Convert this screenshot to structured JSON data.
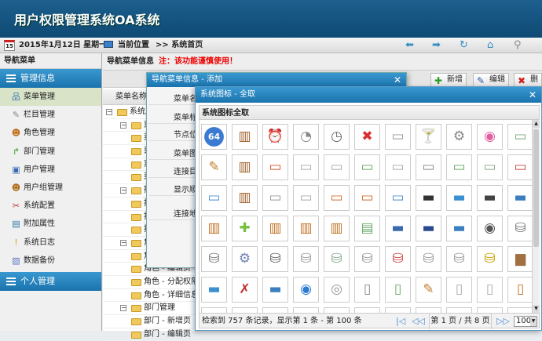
{
  "app": {
    "title": "用户权限管理系统OA系统"
  },
  "topbar": {
    "date": "2015年1月12日 星期一",
    "calendar_day": "15",
    "location_label": "当前位置",
    "breadcrumb": ">> 系统首页"
  },
  "nav": {
    "header": "导航菜单",
    "sections": [
      {
        "label": "管理信息"
      },
      {
        "label": "个人管理"
      }
    ],
    "items": [
      {
        "label": "菜单管理",
        "icon": "sitemap-icon",
        "glyph": "品",
        "color": "#3a7ab0"
      },
      {
        "label": "栏目管理",
        "icon": "wrench-icon",
        "glyph": "✎",
        "color": "#888"
      },
      {
        "label": "角色管理",
        "icon": "users-icon",
        "glyph": "☻",
        "color": "#c07020"
      },
      {
        "label": "部门管理",
        "icon": "branch-icon",
        "glyph": "↱",
        "color": "#3a9a20"
      },
      {
        "label": "用户管理",
        "icon": "user-card-icon",
        "glyph": "▣",
        "color": "#3a6ab0"
      },
      {
        "label": "用户组管理",
        "icon": "user-group-icon",
        "glyph": "☻",
        "color": "#b07020"
      },
      {
        "label": "系统配置",
        "icon": "tools-icon",
        "glyph": "✂",
        "color": "#c03030"
      },
      {
        "label": "附加属性",
        "icon": "book-icon",
        "glyph": "▤",
        "color": "#2a7aa0"
      },
      {
        "label": "系统日志",
        "icon": "warning-icon",
        "glyph": "!",
        "color": "#d8a000"
      },
      {
        "label": "数据备份",
        "icon": "document-icon",
        "glyph": "▧",
        "color": "#5a7ac0"
      }
    ]
  },
  "main": {
    "header": "导航菜单信息",
    "warning": "注：该功能谨慎使用！",
    "buttons": [
      {
        "label": "新增",
        "glyph": "✚",
        "color": "#2a9a2a"
      },
      {
        "label": "编辑",
        "glyph": "✎",
        "color": "#2a5ab0"
      },
      {
        "label": "删除",
        "glyph": "✖",
        "color": "#d02020"
      }
    ],
    "column": "菜单名称",
    "tree": [
      {
        "level": 0,
        "text": "系统应",
        "toggle": "−"
      },
      {
        "level": 1,
        "text": "菜单",
        "toggle": "−"
      },
      {
        "level": 2,
        "text": "菜"
      },
      {
        "level": 2,
        "text": "菜"
      },
      {
        "level": 2,
        "text": "菜"
      },
      {
        "level": 2,
        "text": "菜"
      },
      {
        "level": 1,
        "text": "操作",
        "toggle": "−"
      },
      {
        "level": 2,
        "text": "按"
      },
      {
        "level": 2,
        "text": "按"
      },
      {
        "level": 2,
        "text": "按"
      },
      {
        "level": 1,
        "text": "角色",
        "toggle": "−"
      },
      {
        "level": 2,
        "text": "角"
      },
      {
        "level": 2,
        "text": "角色 - 编辑页"
      },
      {
        "level": 2,
        "text": "角色 - 分配权限页"
      },
      {
        "level": 2,
        "text": "角色 - 详细信息页"
      },
      {
        "level": 1,
        "text": "部门管理",
        "toggle": "−"
      },
      {
        "level": 2,
        "text": "部门 - 新增页"
      },
      {
        "level": 2,
        "text": "部门 - 编辑页"
      }
    ]
  },
  "dialog_add": {
    "title": "导航菜单信息 - 添加",
    "close": "✕",
    "labels": [
      "菜单名",
      "菜单标",
      "节点位",
      "菜单图",
      "连接目",
      "显示顺",
      "连接地"
    ]
  },
  "dialog_icons": {
    "title": "系统图标 - 全取",
    "close": "✕",
    "subtitle": "系统图标全取",
    "icons": [
      [
        "64",
        "#2a6ac0"
      ],
      [
        "▥",
        "#a0602a"
      ],
      [
        "⏰",
        "#3a80c0"
      ],
      [
        "◔",
        "#888"
      ],
      [
        "◷",
        "#666"
      ],
      [
        "✖",
        "#d83030"
      ],
      [
        "▭",
        "#999"
      ],
      [
        "🍸",
        "#c88"
      ],
      [
        "⚙",
        "#888"
      ],
      [
        "◉",
        "#e060a0"
      ],
      [
        "▭",
        "#7a7"
      ],
      [
        "✎",
        "#c08030"
      ],
      [
        "▥",
        "#a0602a"
      ],
      [
        "▭",
        "#d05030"
      ],
      [
        "▭",
        "#aaa"
      ],
      [
        "▭",
        "#aaa"
      ],
      [
        "▭",
        "#6a6"
      ],
      [
        "▭",
        "#aaa"
      ],
      [
        "▭",
        "#888"
      ],
      [
        "▭",
        "#6a6"
      ],
      [
        "▭",
        "#8a8"
      ],
      [
        "▭",
        "#c44"
      ],
      [
        "▭",
        "#4a90d0"
      ],
      [
        "▥",
        "#a0602a"
      ],
      [
        "▭",
        "#999"
      ],
      [
        "▭",
        "#aaa"
      ],
      [
        "▭",
        "#d07030"
      ],
      [
        "▭",
        "#d07030"
      ],
      [
        "▭",
        "#4a90d0"
      ],
      [
        "▬",
        "#333"
      ],
      [
        "▬",
        "#3a90d0"
      ],
      [
        "▬",
        "#444"
      ],
      [
        "▬",
        "#3a80c0"
      ],
      [
        "▥",
        "#c07020"
      ],
      [
        "✚",
        "#7ac040"
      ],
      [
        "▥",
        "#c07020"
      ],
      [
        "▥",
        "#c07020"
      ],
      [
        "▥",
        "#c07020"
      ],
      [
        "▤",
        "#6a6"
      ],
      [
        "▬",
        "#3a6ab0"
      ],
      [
        "▬",
        "#2a4a90"
      ],
      [
        "▬",
        "#3a80c0"
      ],
      [
        "◉",
        "#555"
      ],
      [
        "⛁",
        "#777"
      ],
      [
        "⛁",
        "#777"
      ],
      [
        "⚙",
        "#7080b0"
      ],
      [
        "⛁",
        "#666"
      ],
      [
        "⛁",
        "#999"
      ],
      [
        "⛁",
        "#8a8"
      ],
      [
        "⛁",
        "#999"
      ],
      [
        "⛁",
        "#c44"
      ],
      [
        "⛁",
        "#999"
      ],
      [
        "⛁",
        "#999"
      ],
      [
        "⛁",
        "#c9a000"
      ],
      [
        "▆",
        "#a07040"
      ],
      [
        "▬",
        "#3a90d0"
      ],
      [
        "✗",
        "#c03030"
      ],
      [
        "▬",
        "#3a80c0"
      ],
      [
        "◉",
        "#2a7ad0"
      ],
      [
        "◎",
        "#999"
      ],
      [
        "▯",
        "#888"
      ],
      [
        "▯",
        "#6a6"
      ],
      [
        "✎",
        "#c08030"
      ],
      [
        "▯",
        "#aaa"
      ],
      [
        "▯",
        "#aaa"
      ],
      [
        "▯",
        "#c07020"
      ],
      [
        "▯",
        "#c07020"
      ],
      [
        "▯",
        "#a07040"
      ],
      [
        "▯",
        "#4a90d0"
      ],
      [
        "▯",
        "#aaa"
      ],
      [
        "▭",
        "#888"
      ],
      [
        "▯",
        "#6a6"
      ],
      [
        "▯",
        "#c07020"
      ],
      [
        "▯",
        "#c07020"
      ],
      [
        "▯",
        "#aaa"
      ],
      [
        "▯",
        "#888"
      ],
      [
        "▯",
        "#aaa"
      ]
    ],
    "footer": "检索到 757 条记录，显示第 1 条 - 第 100 条",
    "page_info": "第 1 页 / 共 8 页",
    "page_size": "100",
    "pager": {
      "first": "|◁",
      "prev": "◁◁",
      "next": "▷▷",
      "last": "▷|"
    }
  }
}
